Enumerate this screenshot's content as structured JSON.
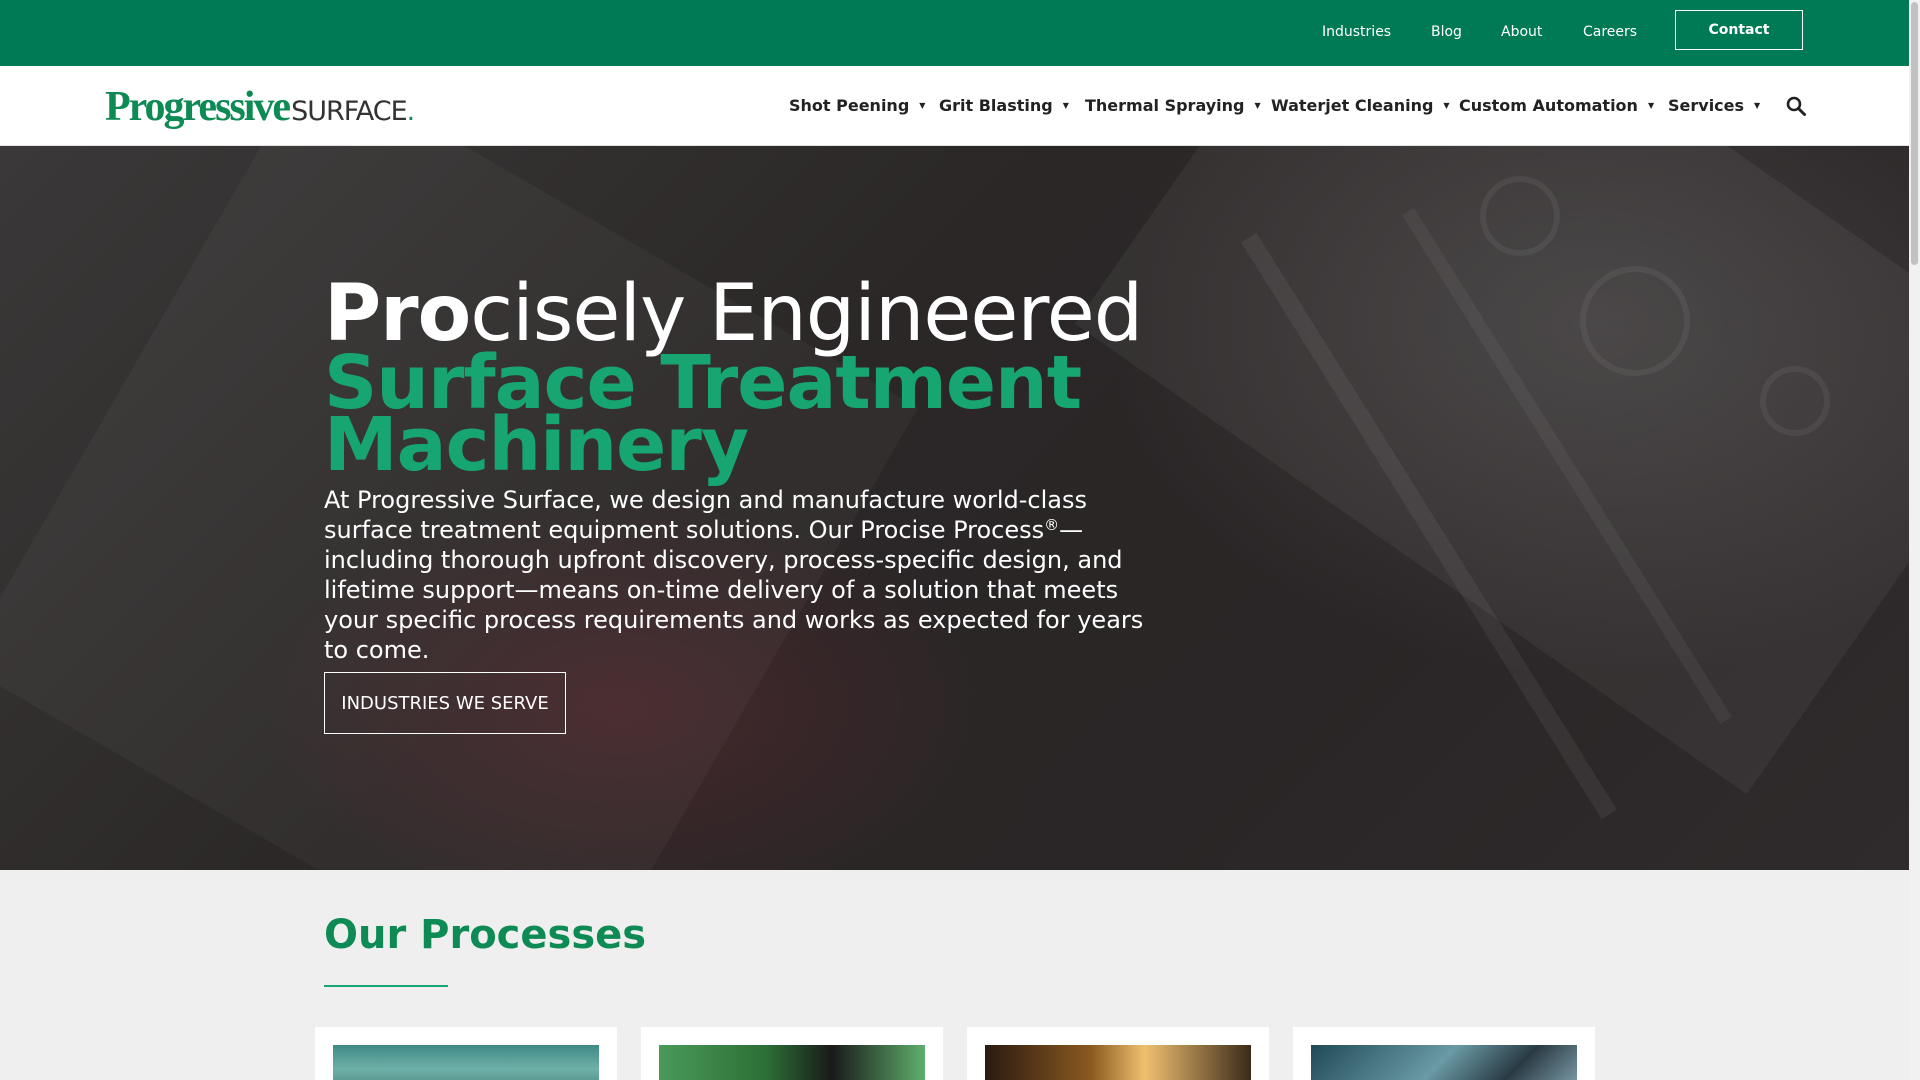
{
  "topbar": {
    "links": [
      "Industries",
      "Blog",
      "About",
      "Careers"
    ],
    "contact_label": "Contact"
  },
  "logo": {
    "bold": "Progressive",
    "thin": "SURFACE",
    "dot": "."
  },
  "nav": {
    "items": [
      {
        "label": "Shot Peening"
      },
      {
        "label": "Grit Blasting"
      },
      {
        "label": "Thermal Spraying"
      },
      {
        "label": "Waterjet Cleaning"
      },
      {
        "label": "Custom Automation"
      },
      {
        "label": "Services"
      }
    ],
    "search_icon": "search-icon"
  },
  "hero": {
    "title_bold": "Pro",
    "title_rest": "cisely Engineered",
    "title_green_1": "Surface Treatment",
    "title_green_2": "Machinery",
    "body_1": "At Progressive Surface, we design and manufacture world-class surface treatment equipment solutions. Our Procise Process",
    "body_sup": "®",
    "body_2": "—including thorough upfront discovery, process-specific design, and lifetime support—means on-time delivery of a solution that meets your specific process requirements and works as expected for years to come.",
    "button_label": "INDUSTRIES WE SERVE"
  },
  "processes": {
    "title_light": "Our",
    "title_bold": "Processes"
  },
  "colors": {
    "brand_green": "#007a55",
    "accent_green": "#17a572",
    "hero_dark": "#2b2727"
  }
}
